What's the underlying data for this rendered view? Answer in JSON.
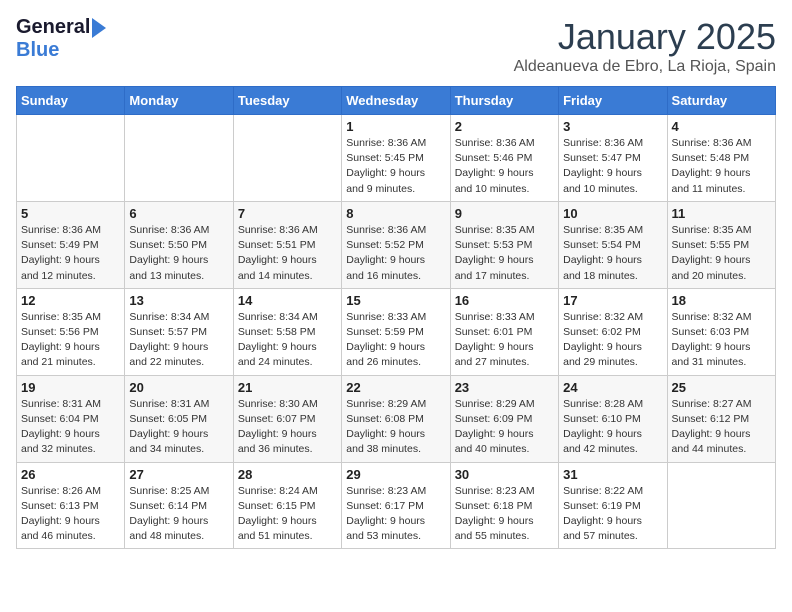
{
  "logo": {
    "general": "General",
    "blue": "Blue"
  },
  "title": "January 2025",
  "location": "Aldeanueva de Ebro, La Rioja, Spain",
  "weekdays": [
    "Sunday",
    "Monday",
    "Tuesday",
    "Wednesday",
    "Thursday",
    "Friday",
    "Saturday"
  ],
  "weeks": [
    [
      {
        "day": "",
        "info": ""
      },
      {
        "day": "",
        "info": ""
      },
      {
        "day": "",
        "info": ""
      },
      {
        "day": "1",
        "info": "Sunrise: 8:36 AM\nSunset: 5:45 PM\nDaylight: 9 hours\nand 9 minutes."
      },
      {
        "day": "2",
        "info": "Sunrise: 8:36 AM\nSunset: 5:46 PM\nDaylight: 9 hours\nand 10 minutes."
      },
      {
        "day": "3",
        "info": "Sunrise: 8:36 AM\nSunset: 5:47 PM\nDaylight: 9 hours\nand 10 minutes."
      },
      {
        "day": "4",
        "info": "Sunrise: 8:36 AM\nSunset: 5:48 PM\nDaylight: 9 hours\nand 11 minutes."
      }
    ],
    [
      {
        "day": "5",
        "info": "Sunrise: 8:36 AM\nSunset: 5:49 PM\nDaylight: 9 hours\nand 12 minutes."
      },
      {
        "day": "6",
        "info": "Sunrise: 8:36 AM\nSunset: 5:50 PM\nDaylight: 9 hours\nand 13 minutes."
      },
      {
        "day": "7",
        "info": "Sunrise: 8:36 AM\nSunset: 5:51 PM\nDaylight: 9 hours\nand 14 minutes."
      },
      {
        "day": "8",
        "info": "Sunrise: 8:36 AM\nSunset: 5:52 PM\nDaylight: 9 hours\nand 16 minutes."
      },
      {
        "day": "9",
        "info": "Sunrise: 8:35 AM\nSunset: 5:53 PM\nDaylight: 9 hours\nand 17 minutes."
      },
      {
        "day": "10",
        "info": "Sunrise: 8:35 AM\nSunset: 5:54 PM\nDaylight: 9 hours\nand 18 minutes."
      },
      {
        "day": "11",
        "info": "Sunrise: 8:35 AM\nSunset: 5:55 PM\nDaylight: 9 hours\nand 20 minutes."
      }
    ],
    [
      {
        "day": "12",
        "info": "Sunrise: 8:35 AM\nSunset: 5:56 PM\nDaylight: 9 hours\nand 21 minutes."
      },
      {
        "day": "13",
        "info": "Sunrise: 8:34 AM\nSunset: 5:57 PM\nDaylight: 9 hours\nand 22 minutes."
      },
      {
        "day": "14",
        "info": "Sunrise: 8:34 AM\nSunset: 5:58 PM\nDaylight: 9 hours\nand 24 minutes."
      },
      {
        "day": "15",
        "info": "Sunrise: 8:33 AM\nSunset: 5:59 PM\nDaylight: 9 hours\nand 26 minutes."
      },
      {
        "day": "16",
        "info": "Sunrise: 8:33 AM\nSunset: 6:01 PM\nDaylight: 9 hours\nand 27 minutes."
      },
      {
        "day": "17",
        "info": "Sunrise: 8:32 AM\nSunset: 6:02 PM\nDaylight: 9 hours\nand 29 minutes."
      },
      {
        "day": "18",
        "info": "Sunrise: 8:32 AM\nSunset: 6:03 PM\nDaylight: 9 hours\nand 31 minutes."
      }
    ],
    [
      {
        "day": "19",
        "info": "Sunrise: 8:31 AM\nSunset: 6:04 PM\nDaylight: 9 hours\nand 32 minutes."
      },
      {
        "day": "20",
        "info": "Sunrise: 8:31 AM\nSunset: 6:05 PM\nDaylight: 9 hours\nand 34 minutes."
      },
      {
        "day": "21",
        "info": "Sunrise: 8:30 AM\nSunset: 6:07 PM\nDaylight: 9 hours\nand 36 minutes."
      },
      {
        "day": "22",
        "info": "Sunrise: 8:29 AM\nSunset: 6:08 PM\nDaylight: 9 hours\nand 38 minutes."
      },
      {
        "day": "23",
        "info": "Sunrise: 8:29 AM\nSunset: 6:09 PM\nDaylight: 9 hours\nand 40 minutes."
      },
      {
        "day": "24",
        "info": "Sunrise: 8:28 AM\nSunset: 6:10 PM\nDaylight: 9 hours\nand 42 minutes."
      },
      {
        "day": "25",
        "info": "Sunrise: 8:27 AM\nSunset: 6:12 PM\nDaylight: 9 hours\nand 44 minutes."
      }
    ],
    [
      {
        "day": "26",
        "info": "Sunrise: 8:26 AM\nSunset: 6:13 PM\nDaylight: 9 hours\nand 46 minutes."
      },
      {
        "day": "27",
        "info": "Sunrise: 8:25 AM\nSunset: 6:14 PM\nDaylight: 9 hours\nand 48 minutes."
      },
      {
        "day": "28",
        "info": "Sunrise: 8:24 AM\nSunset: 6:15 PM\nDaylight: 9 hours\nand 51 minutes."
      },
      {
        "day": "29",
        "info": "Sunrise: 8:23 AM\nSunset: 6:17 PM\nDaylight: 9 hours\nand 53 minutes."
      },
      {
        "day": "30",
        "info": "Sunrise: 8:23 AM\nSunset: 6:18 PM\nDaylight: 9 hours\nand 55 minutes."
      },
      {
        "day": "31",
        "info": "Sunrise: 8:22 AM\nSunset: 6:19 PM\nDaylight: 9 hours\nand 57 minutes."
      },
      {
        "day": "",
        "info": ""
      }
    ]
  ]
}
